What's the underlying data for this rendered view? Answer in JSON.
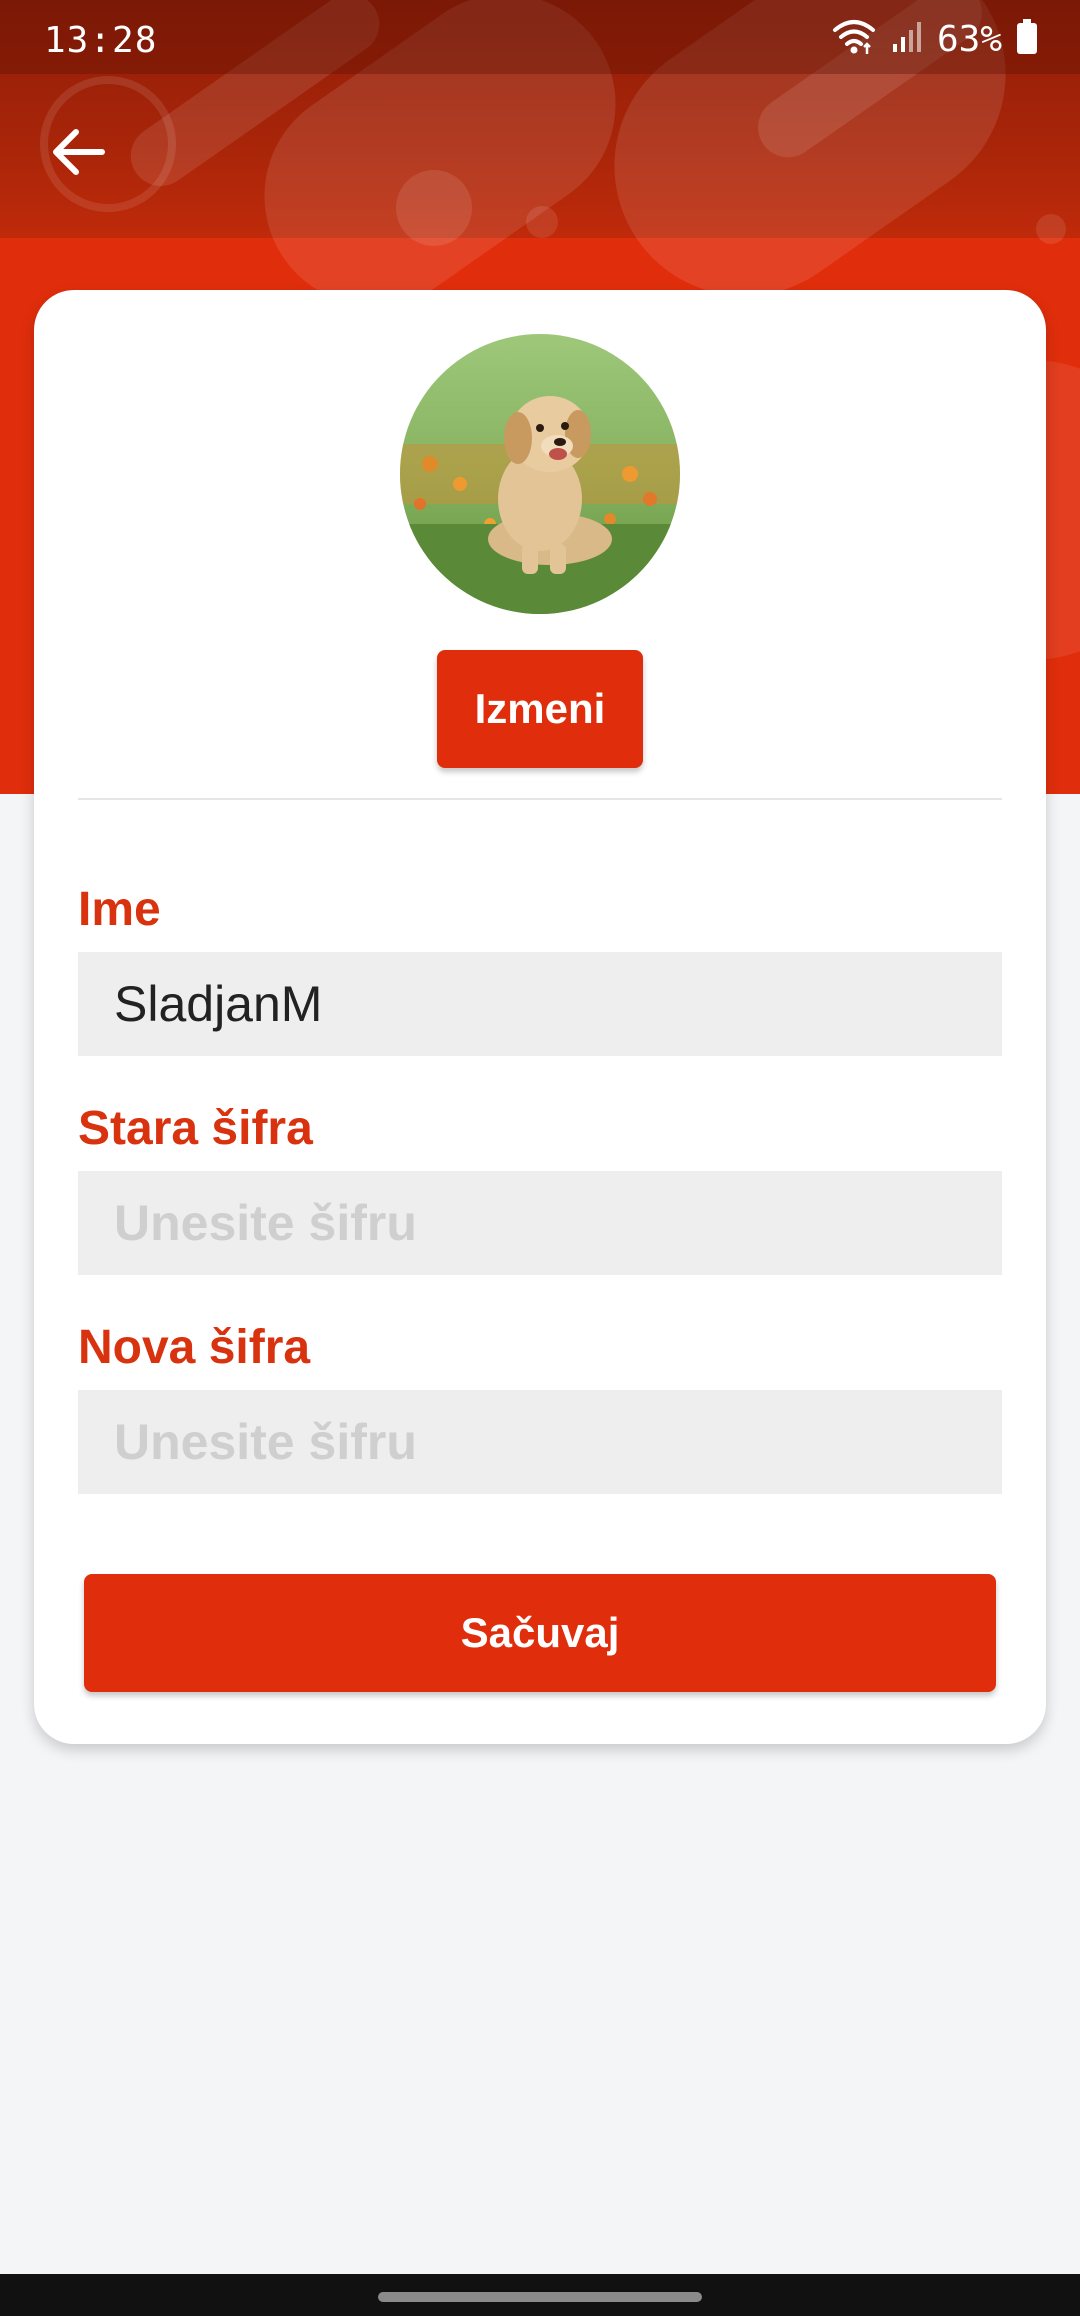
{
  "status_bar": {
    "time": "13:28",
    "battery_percent": "63%",
    "icons": [
      "wifi-icon",
      "signal-icon",
      "battery-icon"
    ]
  },
  "header": {
    "back_icon": "arrow-left-icon"
  },
  "profile": {
    "avatar_description": "puppy-photo",
    "edit_label": "Izmeni"
  },
  "form": {
    "name": {
      "label": "Ime",
      "value": "SladjanM"
    },
    "old_password": {
      "label": "Stara šifra",
      "value": "",
      "placeholder": "Unesite šifru"
    },
    "new_password": {
      "label": "Nova šifra",
      "value": "",
      "placeholder": "Unesite šifru"
    },
    "save_label": "Sačuvaj"
  },
  "colors": {
    "accent": "#e02e0c",
    "label": "#d8320f",
    "background": "#f4f5f7",
    "input_bg": "#eeeeee"
  }
}
